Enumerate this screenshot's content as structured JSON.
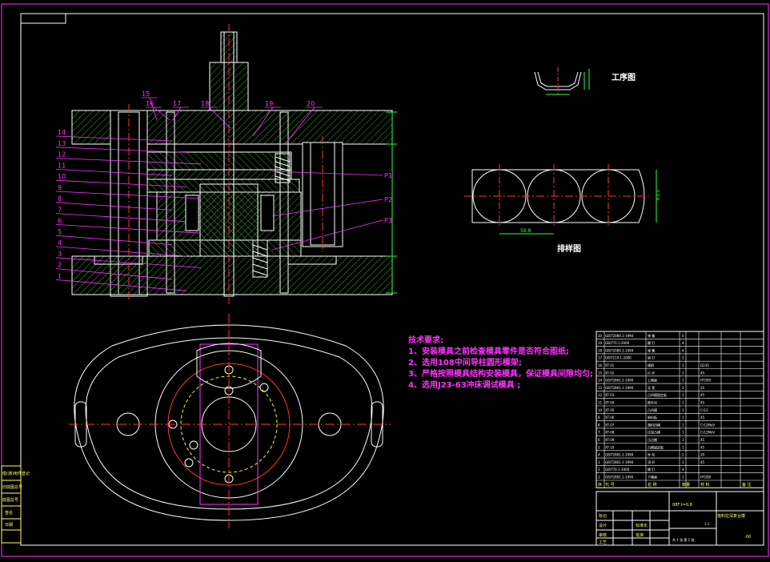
{
  "colors": {
    "background": "#000000",
    "border": "#ff33ff",
    "outline": "#ffffff",
    "hatch": "#33aa33",
    "centerline": "#ff3333",
    "leader": "#ff33ff",
    "dimension": "#33ff33",
    "hidden": "#ffff00"
  },
  "views": {
    "process_label": "工序图",
    "blank_label": "排样图",
    "blank_dim": "59.8",
    "blank_side_dim": "63.5"
  },
  "part_numbers_left": [
    "14",
    "13",
    "12",
    "11",
    "10",
    "9",
    "8",
    "7",
    "6",
    "5",
    "4",
    "3",
    "2",
    "1"
  ],
  "part_numbers_top": [
    "15",
    "16",
    "17",
    "18",
    "19",
    "20"
  ],
  "part_labels_right": [
    "P1",
    "P2",
    "P3"
  ],
  "requirements": {
    "title": "技术要求:",
    "items": [
      "1、安装模具之前检查模具零件是否符合图纸;",
      "2、选用108中间导柱圆形模架;",
      "3、严格按照模具结构安装模具，保证模具间隙均匀;",
      "4、选用J23-63冲床调试模具 ;"
    ]
  },
  "bom": {
    "rows": [
      {
        "no": "20",
        "code": "GB/T2089.1-1994",
        "name": "弹 簧",
        "qty": "4",
        "mat": "",
        "note": ""
      },
      {
        "no": "19",
        "code": "GB/T70.1-2000",
        "name": "螺 钉",
        "qty": "4",
        "mat": "",
        "note": ""
      },
      {
        "no": "18",
        "code": "GB/T2089.1-1994",
        "name": "弹 簧",
        "qty": "4",
        "mat": "",
        "note": ""
      },
      {
        "no": "17",
        "code": "GB/T119.1-2000",
        "name": "销 钉",
        "qty": "2",
        "mat": "",
        "note": ""
      },
      {
        "no": "16",
        "code": "XT-01",
        "name": "模柄",
        "qty": "1",
        "mat": "Q235",
        "note": ""
      },
      {
        "no": "15",
        "code": "XT-02",
        "name": "打 杆",
        "qty": "1",
        "mat": "45",
        "note": ""
      },
      {
        "no": "14",
        "code": "GB/T2861.1-1990",
        "name": "上模座",
        "qty": "1",
        "mat": "HT200",
        "note": ""
      },
      {
        "no": "13",
        "code": "GB/T2861.1-1990",
        "name": "导 套",
        "qty": "2",
        "mat": "20",
        "note": ""
      },
      {
        "no": "12",
        "code": "XT-03",
        "name": "凸凹模固定板",
        "qty": "1",
        "mat": "45",
        "note": ""
      },
      {
        "no": "11",
        "code": "XT-04",
        "name": "推件块",
        "qty": "1",
        "mat": "45",
        "note": ""
      },
      {
        "no": "10",
        "code": "XT-05",
        "name": "凸凹模",
        "qty": "1",
        "mat": "Cr12",
        "note": ""
      },
      {
        "no": "9",
        "code": "XT-06",
        "name": "卸料板",
        "qty": "1",
        "mat": "45",
        "note": ""
      },
      {
        "no": "8",
        "code": "XT-07",
        "name": "落料凹模",
        "qty": "1",
        "mat": "Cr12MoV",
        "note": ""
      },
      {
        "no": "7",
        "code": "XT-08",
        "name": "拉深凸模",
        "qty": "1",
        "mat": "Cr12MoV",
        "note": ""
      },
      {
        "no": "6",
        "code": "XT-09",
        "name": "压边圈",
        "qty": "1",
        "mat": "45",
        "note": ""
      },
      {
        "no": "5",
        "code": "XT-10",
        "name": "凸模固定板",
        "qty": "1",
        "mat": "45",
        "note": ""
      },
      {
        "no": "4",
        "code": "GB/T2861.1-1990",
        "name": "导 柱",
        "qty": "2",
        "mat": "20",
        "note": ""
      },
      {
        "no": "3",
        "code": "GB/T2861.1-1990",
        "name": "顶 杆",
        "qty": "3",
        "mat": "45",
        "note": ""
      },
      {
        "no": "2",
        "code": "GB/T70.1-2000",
        "name": "螺 钉",
        "qty": "4",
        "mat": "",
        "note": ""
      },
      {
        "no": "1",
        "code": "GB/T2861.1-1990",
        "name": "下模座",
        "qty": "1",
        "mat": "HT200",
        "note": ""
      }
    ],
    "header": {
      "no": "序",
      "code": "代 号",
      "name": "名 称",
      "qty": "数量",
      "mat": "材 料",
      "note": "备 注"
    }
  },
  "title_block": {
    "drawing_title": "落料拉深复合模",
    "scale_label": "1:1",
    "sheet": "共 1 张  第 1 张",
    "code": "-00",
    "rows": [
      "标记",
      "处数",
      "分区",
      "更改文件号",
      "签名",
      "年 月 日"
    ],
    "roles": [
      "设计",
      "审核",
      "工艺",
      "标准化",
      "批准"
    ],
    "material": "08F t=0.8"
  },
  "side_table": [
    "借(通)用件登记",
    "旧底图总号",
    "底图总号",
    "签名",
    "日期"
  ]
}
